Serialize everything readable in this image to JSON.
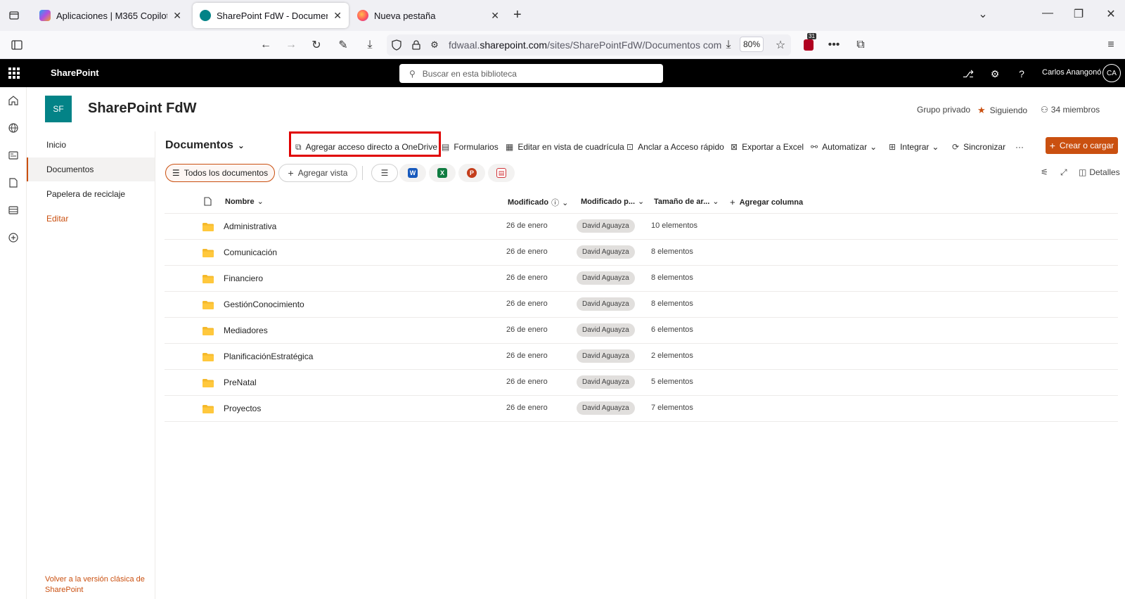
{
  "browser": {
    "tabs": [
      {
        "title": "Aplicaciones | M365 Copilot",
        "active": false
      },
      {
        "title": "SharePoint FdW - Documentos",
        "active": true
      },
      {
        "title": "Nueva pestaña",
        "active": false
      }
    ],
    "url_host": "fdwaal.sharepoint.com",
    "url_path": "/sites/SharePointFdW/Documentos com",
    "url_prefix": "fdwaal.",
    "url_domain": "sharepoint.com",
    "zoom": "80%",
    "extension_badge": "31"
  },
  "suite": {
    "brand": "SharePoint",
    "search_placeholder": "Buscar en esta biblioteca",
    "user_name": "Carlos Anangonó",
    "user_initials": "CA"
  },
  "site": {
    "logo_initials": "SF",
    "title": "SharePoint FdW",
    "privacy": "Grupo privado",
    "follow_label": "Siguiendo",
    "members_label": "34 miembros"
  },
  "leftnav": {
    "items": [
      "Inicio",
      "Documentos",
      "Papelera de reciclaje",
      "Editar"
    ],
    "classic_link": "Volver a la versión clásica de SharePoint"
  },
  "library": {
    "title": "Documentos",
    "commands": {
      "onedrive": "Agregar acceso directo a OneDrive",
      "forms": "Formularios",
      "grid": "Editar en vista de cuadrícula",
      "pin": "Anclar a Acceso rápido",
      "excel": "Exportar a Excel",
      "automate": "Automatizar",
      "integrate": "Integrar",
      "sync": "Sincronizar",
      "more": "···",
      "create": "Crear o cargar"
    },
    "views": {
      "all": "Todos los documentos",
      "add": "Agregar vista",
      "details": "Detalles"
    },
    "columns": {
      "name": "Nombre",
      "modified": "Modificado",
      "modified_by": "Modificado p...",
      "size": "Tamaño de ar...",
      "add": "Agregar columna"
    },
    "rows": [
      {
        "name": "Administrativa",
        "modified": "26 de enero",
        "by": "David Aguayza",
        "size": "10 elementos"
      },
      {
        "name": "Comunicación",
        "modified": "26 de enero",
        "by": "David Aguayza",
        "size": "8 elementos"
      },
      {
        "name": "Financiero",
        "modified": "26 de enero",
        "by": "David Aguayza",
        "size": "8 elementos"
      },
      {
        "name": "GestiónConocimiento",
        "modified": "26 de enero",
        "by": "David Aguayza",
        "size": "8 elementos"
      },
      {
        "name": "Mediadores",
        "modified": "26 de enero",
        "by": "David Aguayza",
        "size": "6 elementos"
      },
      {
        "name": "PlanificaciónEstratégica",
        "modified": "26 de enero",
        "by": "David Aguayza",
        "size": "2 elementos"
      },
      {
        "name": "PreNatal",
        "modified": "26 de enero",
        "by": "David Aguayza",
        "size": "5 elementos"
      },
      {
        "name": "Proyectos",
        "modified": "26 de enero",
        "by": "David Aguayza",
        "size": "7 elementos"
      }
    ]
  },
  "colors": {
    "accent": "#ca5010",
    "site_logo": "#038387",
    "suite_bar": "#000000",
    "highlight": "#e00000"
  }
}
